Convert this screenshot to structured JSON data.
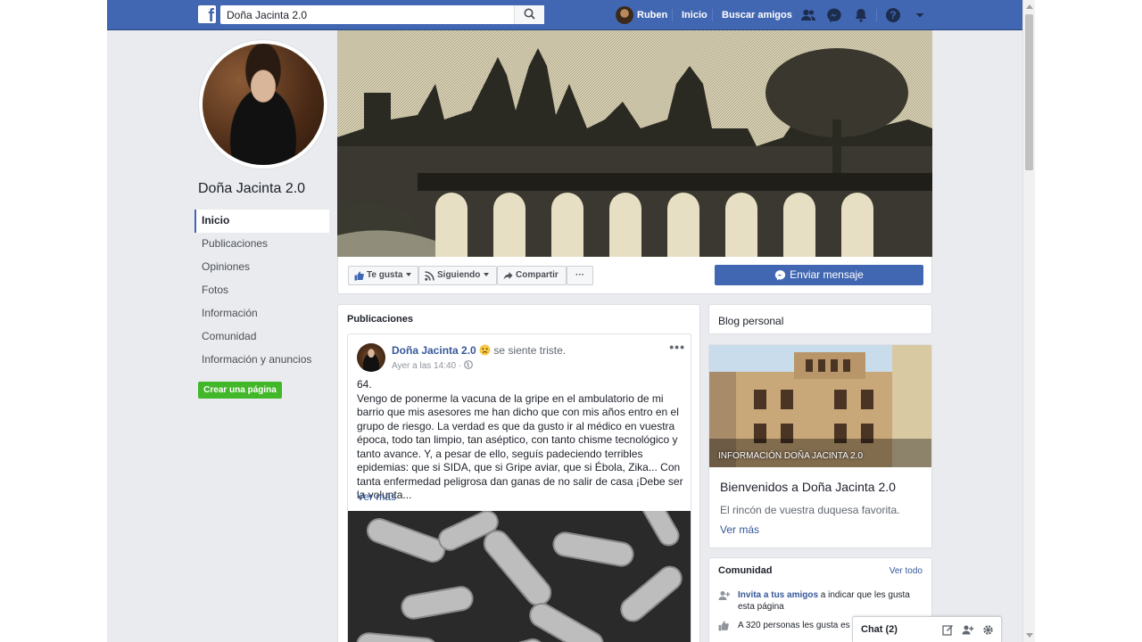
{
  "topbar": {
    "search_value": "Doña Jacinta 2.0",
    "user_name": "Ruben",
    "home": "Inicio",
    "find_friends": "Buscar amigos"
  },
  "left": {
    "page_name": "Doña Jacinta 2.0",
    "nav": [
      {
        "label": "Inicio",
        "active": true
      },
      {
        "label": "Publicaciones"
      },
      {
        "label": "Opiniones"
      },
      {
        "label": "Fotos"
      },
      {
        "label": "Información"
      },
      {
        "label": "Comunidad"
      },
      {
        "label": "Información y anuncios"
      }
    ],
    "create_page": "Crear una página"
  },
  "actions": {
    "like": "Te gusta",
    "following": "Siguiendo",
    "share": "Compartir",
    "more": "···",
    "send_message": "Enviar mensaje"
  },
  "posts": {
    "title": "Publicaciones",
    "author": "Doña Jacinta 2.0",
    "feeling": "se siente triste.",
    "time": "Ayer a las 14:40 ·",
    "dots": "•••",
    "text": "64.\nVengo de ponerme la vacuna de la gripe en el ambulatorio de mi barrio que mis asesores me han dicho que con mis años entro en el grupo de riesgo. La verdad es que da gusto ir al médico en vuestra época, todo tan limpio, tan aséptico, con tanto chisme tecnológico y tanto avance. Y, a pesar de ello, seguís padeciendo terribles epidemias: que si SIDA, que si Gripe aviar, que si Ébola, Zika... Con tanta enfermedad peligrosa dan ganas de no salir de casa ¡Debe ser la volunta...",
    "see_more": "Ver más"
  },
  "right": {
    "blog_title": "Blog personal",
    "info_caption": "INFORMACIÓN DOÑA JACINTA 2.0",
    "info_title": "Bienvenidos a Doña Jacinta 2.0",
    "info_sub": "El rincón de vuestra duquesa favorita.",
    "info_more": "Ver más",
    "community_title": "Comunidad",
    "community_all": "Ver todo",
    "invite_link": "Invita a tus amigos",
    "invite_rest": " a indicar que les gusta esta página",
    "likes_text": "A 320 personas les gusta es"
  },
  "chat": {
    "label": "Chat (2)"
  },
  "colors": {
    "brand": "#4267b2",
    "link": "#365899",
    "green": "#42b72a",
    "bg": "#e9ebee"
  }
}
